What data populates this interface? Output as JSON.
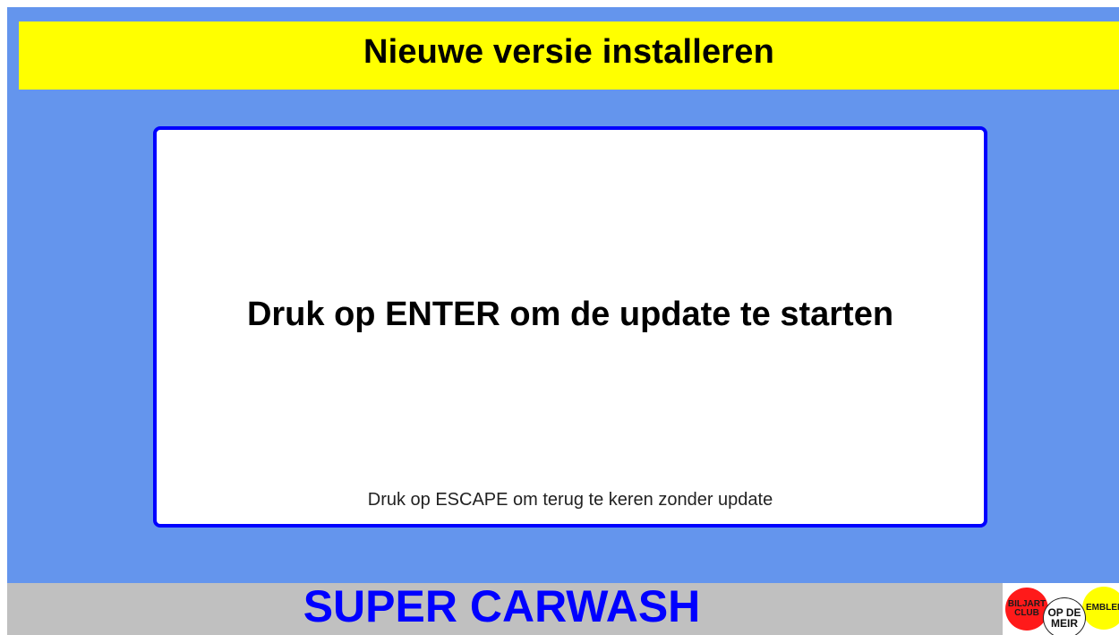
{
  "header": {
    "title": "Nieuwe versie installeren"
  },
  "dialog": {
    "main_message": "Druk op ENTER om de update te starten",
    "secondary_message": "Druk op ESCAPE om terug te keren zonder update"
  },
  "footer": {
    "brand": "SUPER CARWASH",
    "logo": {
      "left_text": "BILJART\nCLUB",
      "center_text": "OP DE\nMEIR",
      "right_text": "EMBLEM"
    }
  },
  "colors": {
    "background": "#6495ed",
    "title_bar": "#ffff00",
    "dialog_border": "#0000ff",
    "brand_text": "#0000ff",
    "footer": "#c0c0c0"
  }
}
